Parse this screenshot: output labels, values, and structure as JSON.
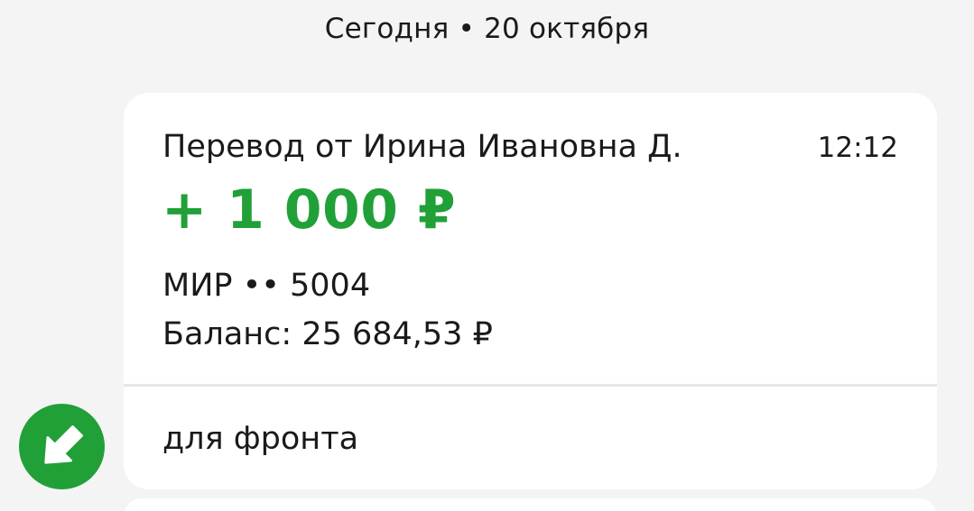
{
  "date_header": "Сегодня • 20 октября",
  "transaction": {
    "title": "Перевод от Ирина Ивановна Д.",
    "time": "12:12",
    "amount": "+ 1 000 ₽",
    "card": "МИР •• 5004",
    "balance": "Баланс: 25 684,53 ₽",
    "comment": "для фронта"
  },
  "icons": {
    "direction": "incoming-arrow-icon"
  },
  "colors": {
    "accent_green": "#21a038",
    "background": "#f4f4f4",
    "card": "#ffffff",
    "text": "#1a1a1a"
  }
}
